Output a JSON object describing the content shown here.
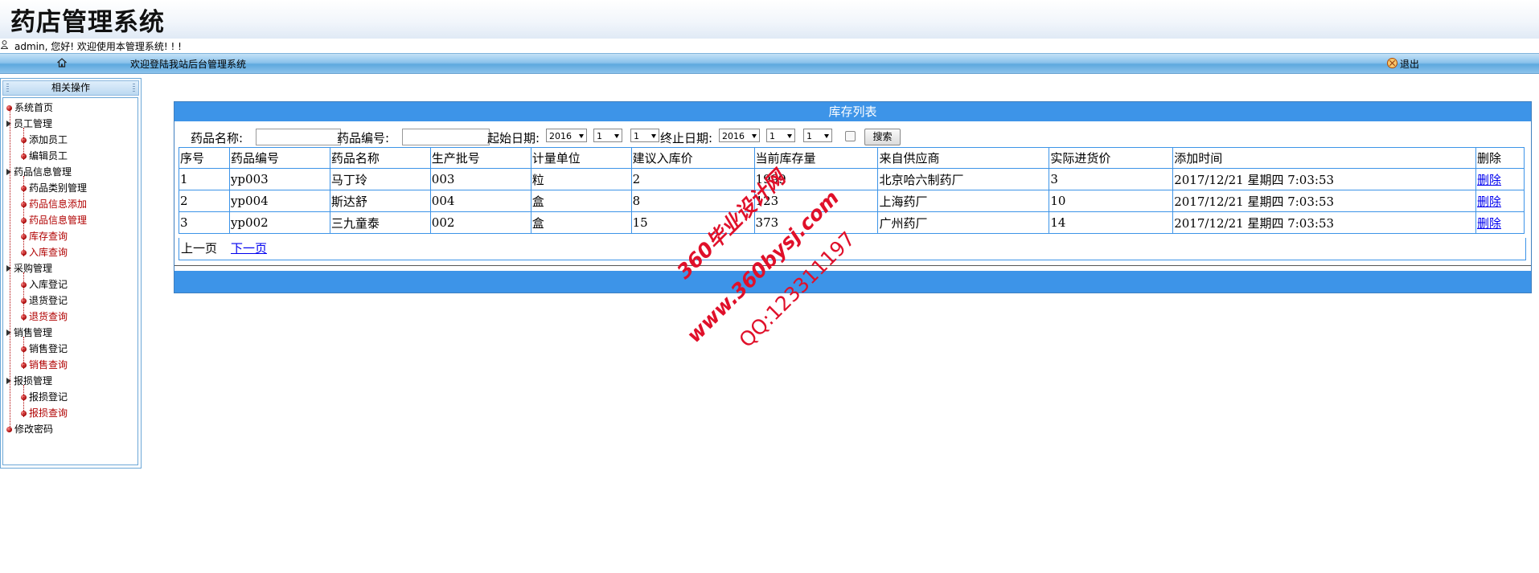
{
  "app": {
    "title": "药店管理系统"
  },
  "welcome": {
    "text": "admin, 您好! 欢迎使用本管理系统! ! !"
  },
  "navbar": {
    "text": "欢迎登陆我站后台管理系统",
    "logout": "退出"
  },
  "sidebar": {
    "header": "相关操作",
    "items": [
      {
        "label": "系统首页",
        "kind": "node"
      },
      {
        "label": "员工管理",
        "kind": "folder"
      },
      {
        "label": "添加员工",
        "kind": "leaf"
      },
      {
        "label": "编辑员工",
        "kind": "leaf"
      },
      {
        "label": "药品信息管理",
        "kind": "folder"
      },
      {
        "label": "药品类别管理",
        "kind": "leaf"
      },
      {
        "label": "药品信息添加",
        "kind": "leaf-red"
      },
      {
        "label": "药品信息管理",
        "kind": "leaf-red"
      },
      {
        "label": "库存查询",
        "kind": "leaf-red"
      },
      {
        "label": "入库查询",
        "kind": "leaf-red"
      },
      {
        "label": "采购管理",
        "kind": "folder"
      },
      {
        "label": "入库登记",
        "kind": "leaf"
      },
      {
        "label": "退货登记",
        "kind": "leaf"
      },
      {
        "label": "退货查询",
        "kind": "leaf-red"
      },
      {
        "label": "销售管理",
        "kind": "folder"
      },
      {
        "label": "销售登记",
        "kind": "leaf"
      },
      {
        "label": "销售查询",
        "kind": "leaf-red"
      },
      {
        "label": "报损管理",
        "kind": "folder"
      },
      {
        "label": "报损登记",
        "kind": "leaf"
      },
      {
        "label": "报损查询",
        "kind": "leaf-red"
      },
      {
        "label": "修改密码",
        "kind": "node"
      }
    ]
  },
  "panel": {
    "title": "库存列表"
  },
  "search": {
    "drug_name_label": "药品名称:",
    "drug_name_value": "",
    "drug_code_label": "药品编号:",
    "drug_code_value": "",
    "start_date_label": "起始日期:",
    "start_year": "2016",
    "start_month": "1",
    "start_day": "1",
    "end_date_label": "终止日期:",
    "end_year": "2016",
    "end_month": "1",
    "end_day": "1",
    "search_button": "搜索"
  },
  "table": {
    "headers": [
      "序号",
      "药品编号",
      "药品名称",
      "生产批号",
      "计量单位",
      "建议入库价",
      "当前库存量",
      "来自供应商",
      "实际进货价",
      "添加时间",
      "删除"
    ],
    "rows": [
      [
        "1",
        "yp003",
        "马丁玲",
        "003",
        "粒",
        "2",
        "1999",
        "北京哈六制药厂",
        "3",
        "2017/12/21 星期四 7:03:53",
        "删除"
      ],
      [
        "2",
        "yp004",
        "斯达舒",
        "004",
        "盒",
        "8",
        "123",
        "上海药厂",
        "10",
        "2017/12/21 星期四 7:03:53",
        "删除"
      ],
      [
        "3",
        "yp002",
        "三九童泰",
        "002",
        "盒",
        "15",
        "373",
        "广州药厂",
        "14",
        "2017/12/21 星期四 7:03:53",
        "删除"
      ]
    ]
  },
  "pager": {
    "prev": "上一页",
    "next": "下一页"
  },
  "watermark": {
    "line1": "360毕业设计网",
    "line2": "www.360bysj.com",
    "line3": "QQ:123311197"
  },
  "colors": {
    "accent": "#3d94e8",
    "nav": "#5ea9de",
    "menu_red": "#b00000",
    "watermark": "#e0102a"
  }
}
